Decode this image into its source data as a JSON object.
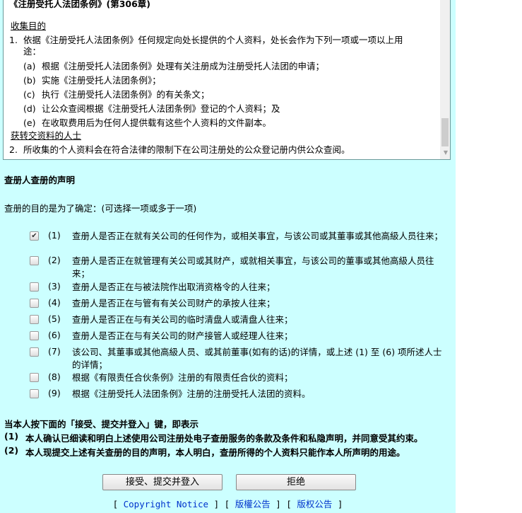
{
  "notice": {
    "title": "《注册受托人法团条例》(第306章)",
    "purpose_heading": "收集目的",
    "item1_num": "1.",
    "item1_text": "依据《注册受托人法团条例》任何规定向处长提供的个人资料，处长会作为下列一项或一项以上用",
    "item1_text2": "途：",
    "subitems": [
      {
        "label": "(a)",
        "text": "根据《注册受托人法团条例》处理有关注册成为注册受托人法团的申请；"
      },
      {
        "label": "(b)",
        "text": "实施《注册受托人法团条例》；"
      },
      {
        "label": "(c)",
        "text": "执行《注册受托人法团条例》的有关条文；"
      },
      {
        "label": "(d)",
        "text": "让公众查阅根据《注册受托人法团条例》登记的个人资料；及"
      },
      {
        "label": "(e)",
        "text": "在收取费用后为任何人提供载有这些个人资料的文件副本。"
      }
    ],
    "transfer_heading": "获转交资料的人士",
    "item2_num": "2.",
    "item2_text": "所收集的个人资料会在符合法律的限制下在公司注册处的公众登记册内供公众查阅。"
  },
  "declaration": {
    "heading": "查册人查册的声明",
    "intro": "查册的目的是为了确定：(可选择一项或多于一项)",
    "options": [
      {
        "num": "(1)",
        "text": "查册人是否正在就有关公司的任何作为，或相关事宜，与该公司或其董事或其他高級人员往来；",
        "checked": true
      },
      {
        "num": "(2)",
        "text": "查册人是否正在就管理有关公司或其财产，或就相关事宜，与该公司的董事或其他高級人员往来；",
        "checked": false
      },
      {
        "num": "(3)",
        "text": "查册人是否正在与被法院作出取消资格令的人往来；",
        "checked": false
      },
      {
        "num": "(4)",
        "text": "查册人是否正在与管有有关公司财产的承按人往来；",
        "checked": false
      },
      {
        "num": "(5)",
        "text": "查册人是否正在与有关公司的临时清盘人或清盘人往来；",
        "checked": false
      },
      {
        "num": "(6)",
        "text": "查册人是否正在与有关公司的财产接管人或经理人往来；",
        "checked": false
      },
      {
        "num": "(7)",
        "text": "该公司、其董事或其他高級人员、或其前董事(如有的话)的详情，或上述 (1) 至 (6) 项所述人士的详情；",
        "checked": false
      },
      {
        "num": "(8)",
        "text": "根据《有限责任合伙条例》注册的有限责任合伙的资料；",
        "checked": false
      },
      {
        "num": "(9)",
        "text": "根据《注册受托人法团条例》注册的注册受托人法团的资料。",
        "checked": false
      }
    ]
  },
  "acceptance": {
    "intro": "当本人按下面的「接受、提交并登入」键，即表示",
    "points": [
      {
        "num": "(1)",
        "text": "本人确认已细读和明白上述使用公司注册处电子查册服务的条款及条件和私隐声明，并同意受其约束。"
      },
      {
        "num": "(2)",
        "text": "本人现提交上述有关查册的目的声明，本人明白，查册所得的个人资料只能作本人所声明的用途。"
      }
    ]
  },
  "buttons": {
    "accept": "接受、提交并登入",
    "reject": "拒绝"
  },
  "links": {
    "open": "[",
    "sep": "] [",
    "close": "]",
    "copyright": "Copyright Notice",
    "trad": "版權公告",
    "simp": "版权公告"
  }
}
